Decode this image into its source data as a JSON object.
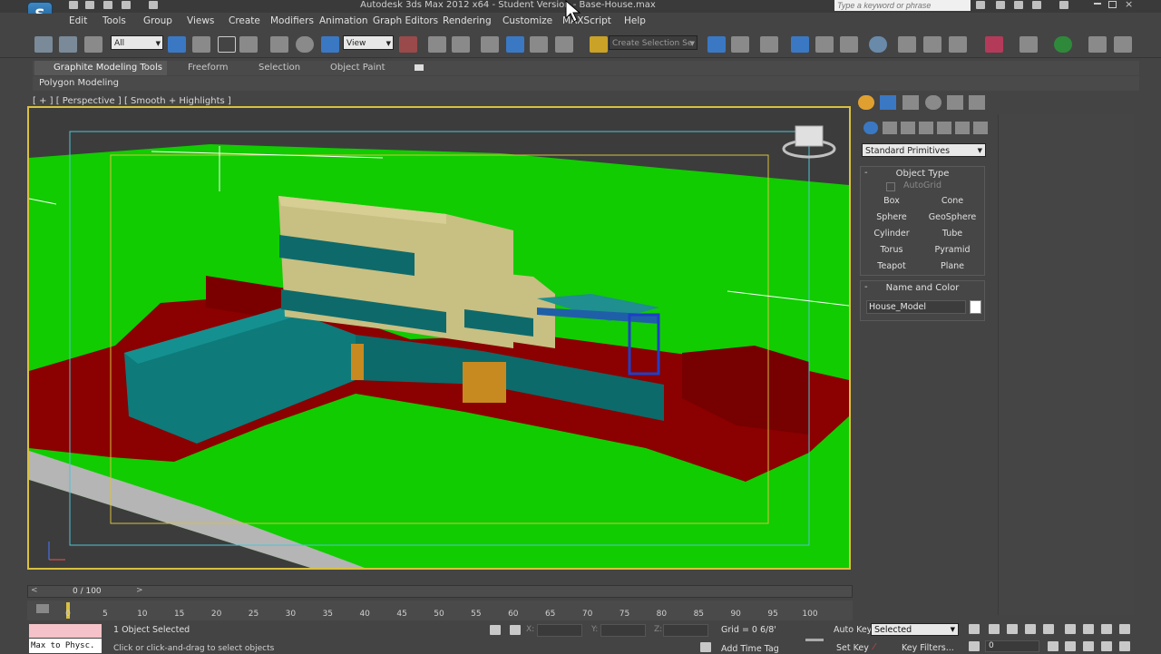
{
  "window": {
    "title": "Autodesk 3ds Max  2012 x64    - Student Version    - Base-House.max",
    "search_placeholder": "Type a keyword or phrase"
  },
  "app_logo": {
    "letter": "S"
  },
  "menu": [
    "Edit",
    "Tools",
    "Group",
    "Views",
    "Create",
    "Modifiers",
    "Animation",
    "Graph Editors",
    "Rendering",
    "Customize",
    "MAXScript",
    "Help"
  ],
  "toolbar": {
    "selection_filter": "All",
    "reference_coord": "View",
    "named_selection": "Create Selection Se"
  },
  "ribbon": {
    "tabs": [
      "Graphite Modeling Tools",
      "Freeform",
      "Selection",
      "Object Paint"
    ],
    "panel_label": "Polygon Modeling"
  },
  "viewport": {
    "label": "[ + ] [ Perspective ] [ Smooth + Highlights ]"
  },
  "command_panel": {
    "category": "Standard Primitives",
    "object_type": {
      "title": "Object Type",
      "autogrid": "AutoGrid",
      "buttons": [
        "Box",
        "Cone",
        "Sphere",
        "GeoSphere",
        "Cylinder",
        "Tube",
        "Torus",
        "Pyramid",
        "Teapot",
        "Plane"
      ]
    },
    "name_and_color": {
      "title": "Name and Color",
      "name": "House_Model"
    }
  },
  "timeline": {
    "frame_label": "0 / 100",
    "ticks": [
      "0",
      "5",
      "10",
      "15",
      "20",
      "25",
      "30",
      "35",
      "40",
      "45",
      "50",
      "55",
      "60",
      "65",
      "70",
      "75",
      "80",
      "85",
      "90",
      "95",
      "100"
    ]
  },
  "status": {
    "selection_info": "1 Object Selected",
    "prompt": "Click or click-and-drag to select objects",
    "x_label": "X:",
    "y_label": "Y:",
    "z_label": "Z:",
    "grid": "Grid = 0 6/8'",
    "add_time_tag": "Add Time Tag",
    "auto_key": "Auto Key",
    "set_key": "Set Key",
    "key_mode": "Selected",
    "key_filters": "Key Filters...",
    "current_frame": "0",
    "maxscript_text": "Max to Physc."
  },
  "colors": {
    "viewport_border": "#d9c040",
    "ground": "#11cc00",
    "slab": "#8b0000",
    "wall_teal": "#0e7a7a",
    "wall_cream": "#c8bf82",
    "accent_blue": "#1f5fa8"
  }
}
